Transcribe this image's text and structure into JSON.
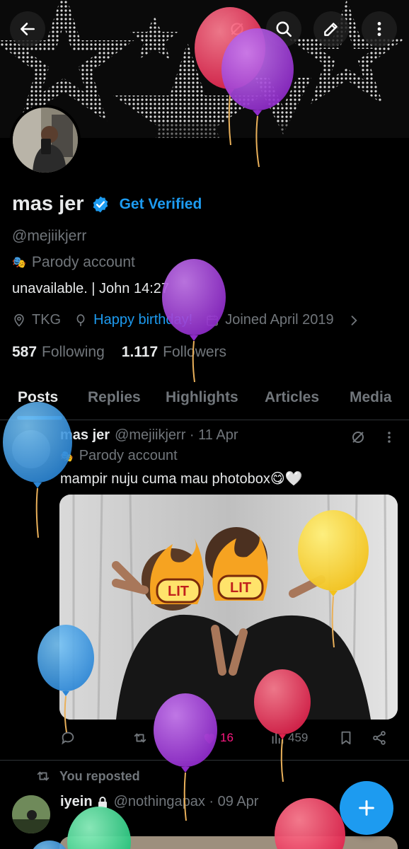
{
  "header": {
    "back_icon": "arrow-left-icon",
    "actions": [
      "parody-icon",
      "search-icon",
      "edit-icon",
      "more-vertical-icon"
    ]
  },
  "profile": {
    "name": "mas jer",
    "verified_cta": "Get Verified",
    "handle": "@mejiikjerr",
    "parody_label": "Parody account",
    "bio": "unavailable. | John 14:27",
    "location": "TKG",
    "birthday": "Happy birthday!",
    "joined": "Joined April 2019",
    "following_count": "587",
    "following_label": "Following",
    "followers_count": "1.117",
    "followers_label": "Followers"
  },
  "tabs": [
    "Posts",
    "Replies",
    "Highlights",
    "Articles",
    "Media"
  ],
  "post": {
    "name": "mas jer",
    "meta": "@mejiikjerr · 11 Apr",
    "parody_label": "Parody account",
    "text": "mampir nuju cuma mau photobox😋🤍",
    "sticker_text": "LIT",
    "likes": "16",
    "views": "459"
  },
  "repost": {
    "label": "You reposted",
    "name": "iyein",
    "meta": "@nothingapax · 09 Apr"
  },
  "colors": {
    "accent": "#1d9bf0",
    "like": "#f91880",
    "muted": "#71767b"
  }
}
